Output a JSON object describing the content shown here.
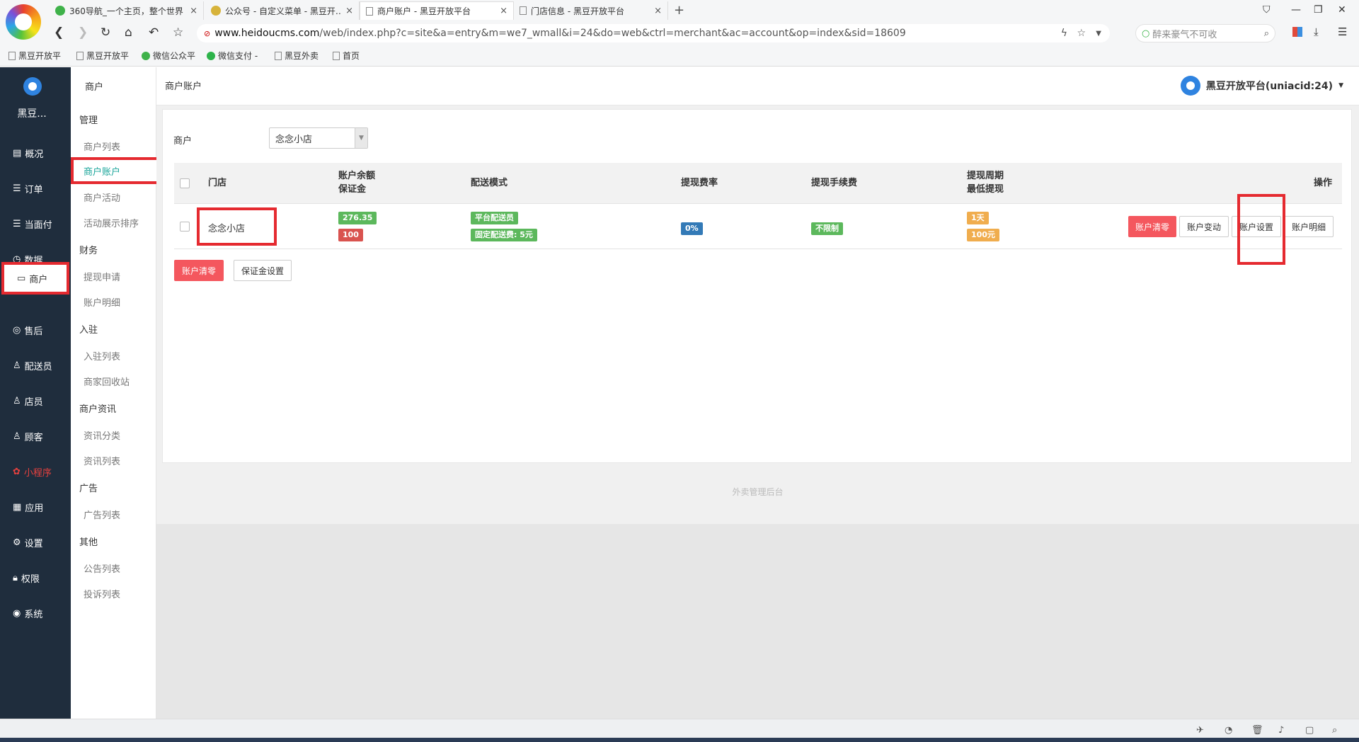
{
  "browser": {
    "tabs": [
      {
        "title": "360导航_一个主页，整个世界",
        "active": false
      },
      {
        "title": "公众号 - 自定义菜单 - 黑豆开…",
        "active": false
      },
      {
        "title": "商户账户 - 黑豆开放平台",
        "active": true
      },
      {
        "title": "门店信息 - 黑豆开放平台",
        "active": false
      }
    ],
    "new_tab": "+",
    "url_host": "www.heidoucms.com",
    "url_path": "/web/index.php?c=site&a=entry&m=we7_wmall&i=24&do=web&ctrl=merchant&ac=account&op=index&sid=18609",
    "search_placeholder": "醉来豪气不可收",
    "bookmarks": [
      "黑豆开放平",
      "黑豆开放平",
      "微信公众平",
      "微信支付 -",
      "黑豆外卖",
      "首页"
    ]
  },
  "sidebar": {
    "brand": "黑豆...",
    "items": [
      {
        "label": "概况",
        "icon": "overview-icon"
      },
      {
        "label": "订单",
        "icon": "order-icon"
      },
      {
        "label": "当面付",
        "icon": "pay-icon"
      },
      {
        "label": "数据",
        "icon": "data-icon"
      },
      {
        "label": "商户",
        "icon": "store-icon"
      },
      {
        "label": "售后",
        "icon": "aftersale-icon"
      },
      {
        "label": "配送员",
        "icon": "courier-icon"
      },
      {
        "label": "店员",
        "icon": "clerk-icon"
      },
      {
        "label": "顾客",
        "icon": "customer-icon"
      },
      {
        "label": "小程序",
        "icon": "miniapp-icon"
      },
      {
        "label": "应用",
        "icon": "apps-icon"
      },
      {
        "label": "设置",
        "icon": "settings-icon"
      },
      {
        "label": "权限",
        "icon": "lock-icon"
      },
      {
        "label": "系统",
        "icon": "system-icon"
      }
    ]
  },
  "submenu": {
    "title": "商户",
    "groups": [
      {
        "label": "管理",
        "items": [
          "商户列表",
          "商户账户",
          "商户活动",
          "活动展示排序"
        ]
      },
      {
        "label": "财务",
        "items": [
          "提现申请",
          "账户明细"
        ]
      },
      {
        "label": "入驻",
        "items": [
          "入驻列表",
          "商家回收站"
        ]
      },
      {
        "label": "商户资讯",
        "items": [
          "资讯分类",
          "资讯列表"
        ]
      },
      {
        "label": "广告",
        "items": [
          "广告列表"
        ]
      },
      {
        "label": "其他",
        "items": [
          "公告列表",
          "投诉列表"
        ]
      }
    ]
  },
  "header": {
    "breadcrumb": "商户账户",
    "account": "黑豆开放平台(uniacid:24)"
  },
  "filter": {
    "label": "商户",
    "value": "念念小店"
  },
  "table": {
    "headers": {
      "store": "门店",
      "balance_line1": "账户余额",
      "balance_line2": "保证金",
      "delivery": "配送模式",
      "rate": "提现费率",
      "fee": "提现手续费",
      "cycle_line1": "提现周期",
      "cycle_line2": "最低提现",
      "actions": "操作"
    },
    "row": {
      "store": "念念小店",
      "balance": "276.35",
      "deposit": "100",
      "delivery_mode": "平台配送员",
      "delivery_fee": "固定配送费: 5元",
      "rate": "0%",
      "fee": "不限制",
      "cycle": "1天",
      "min_withdraw": "100元",
      "actions": [
        "账户清零",
        "账户变动",
        "账户设置",
        "账户明细"
      ]
    }
  },
  "bulk": {
    "clear": "账户清零",
    "deposit": "保证金设置"
  },
  "footer": "外卖管理后台",
  "colors": {
    "sidebar": "#1f2d3d",
    "highlight": "#e52a30",
    "green": "#5cb85c",
    "red": "#d9534f",
    "blue": "#337ab7",
    "orange": "#f0ad4e",
    "danger_btn": "#f4575e",
    "active_sub": "#1aa59a"
  }
}
